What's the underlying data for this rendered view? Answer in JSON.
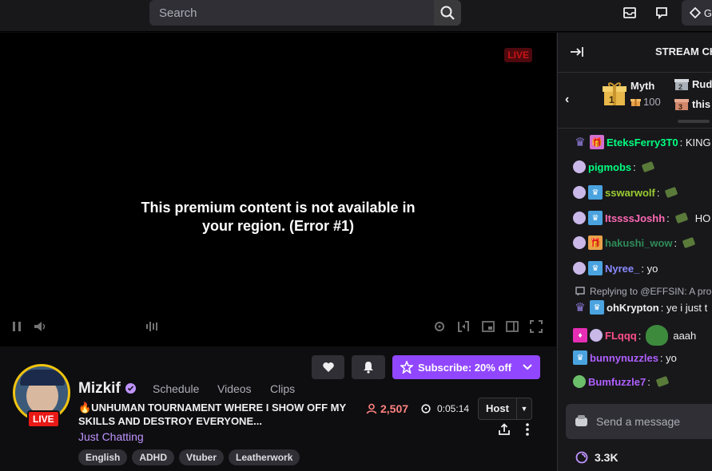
{
  "topbar": {
    "search_placeholder": "Search",
    "prime_label": "G"
  },
  "player": {
    "live_label": "LIVE",
    "error_message": "This premium content is not available in your region. (Error #1)"
  },
  "channel": {
    "name": "Mizkif",
    "live_label": "LIVE",
    "links": [
      "Schedule",
      "Videos",
      "Clips"
    ],
    "title": "🔥UNHUMAN TOURNAMENT WHERE I SHOW OFF MY SKILLS AND DESTROY EVERYONE...",
    "category": "Just Chatting",
    "tags": [
      "English",
      "ADHD",
      "Vtuber",
      "Leatherwork"
    ],
    "viewers": "2,507",
    "uptime": "0:05:14",
    "host_label": "Host",
    "subscribe_label": "Subscribe: 20% off"
  },
  "chat": {
    "header_title": "STREAM CHAT",
    "leaderboard": {
      "first_name": "Myth",
      "first_value": "100",
      "second_name": "Rud",
      "third_name": "this"
    },
    "messages": [
      {
        "user": "EteksFerry3T0",
        "color": "#00ff7f",
        "text": ": KING"
      },
      {
        "user": "pigmobs",
        "color": "#00ff7f",
        "text": ":"
      },
      {
        "user": "sswarwolf",
        "color": "#9acd32",
        "text": ":"
      },
      {
        "user": "ItssssJoshh",
        "color": "#ff69b4",
        "text": ":"
      },
      {
        "user": "hakushi_wow",
        "color": "#2e8b57",
        "text": ":"
      },
      {
        "user": "Nyree_",
        "color": "#8a8aff",
        "text": ": yo"
      },
      {
        "user": "ohKrypton",
        "color": "#efeff1",
        "text": ": ye i just t"
      },
      {
        "user": "FLqqq",
        "color": "#ff4f8a",
        "text": ": "
      },
      {
        "user": "bunnynuzzles",
        "color": "#b05fff",
        "text": ": yo"
      },
      {
        "user": "Bumfuzzle7",
        "color": "#b05fff",
        "text": ":"
      }
    ],
    "reply_text": "Replying to @EFFSIN: A pro",
    "flqqq_msg": "aaah",
    "third_msg_extra": "HO",
    "input_placeholder": "Send a message",
    "points": "3.3K"
  },
  "colors": {
    "accent": "#9147ff",
    "live": "#e91916",
    "viewers": "#ff8280"
  }
}
